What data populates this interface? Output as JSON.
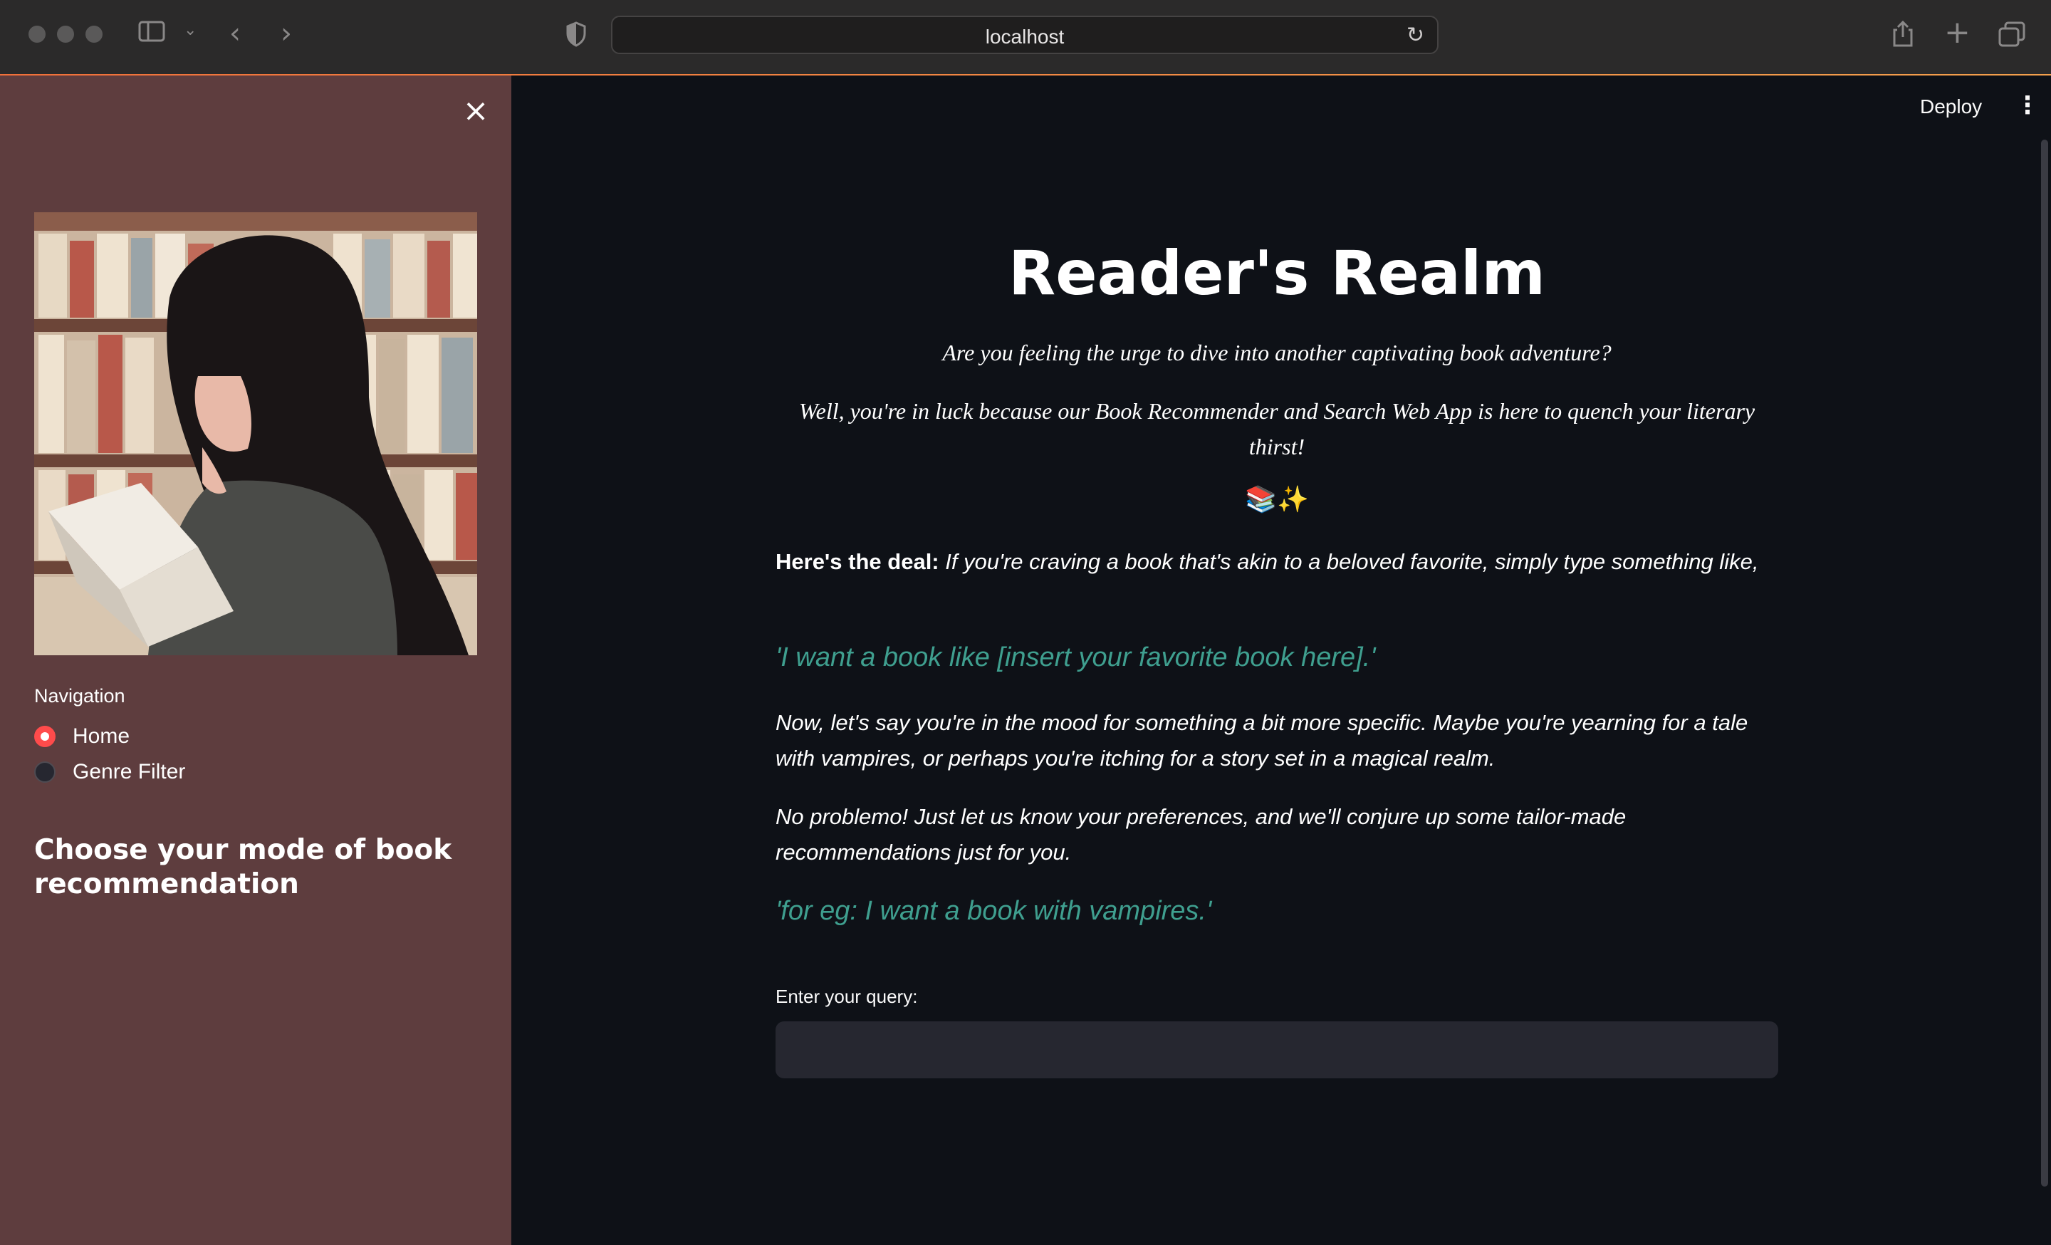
{
  "browser": {
    "url": "localhost"
  },
  "sidebar": {
    "close_label": "×",
    "image_desc": "anime-girl-reading-book-illustration",
    "navigation_label": "Navigation",
    "options": [
      {
        "label": "Home",
        "selected": true
      },
      {
        "label": "Genre Filter",
        "selected": false
      }
    ],
    "heading": "Choose your mode of book recommendation"
  },
  "header": {
    "deploy_label": "Deploy",
    "menu_icon": "⋮"
  },
  "main": {
    "title": "Reader's Realm",
    "intro_line1": "Are you feeling the urge to dive into another captivating book adventure?",
    "intro_line2": "Well, you're in luck because our Book Recommender and Search Web App is here to quench your literary thirst!",
    "emoji": "📚✨",
    "deal_bold": "Here's the deal:",
    "deal_text": " If you're craving a book that's akin to a beloved favorite, simply type something like,",
    "example1": "'I want a book like [insert your favorite book here].'",
    "para2": "Now, let's say you're in the mood for something a bit more specific. Maybe you're yearning for a tale with vampires, or perhaps you're itching for a story set in a magical realm.",
    "para3": "No problemo! Just let us know your preferences, and we'll conjure up some tailor-made recommendations just for you.",
    "example2": "'for eg: I want a book with vampires.'",
    "query_label": "Enter your query:",
    "query_value": ""
  },
  "colors": {
    "sidebar_bg": "#5e3d3e",
    "main_bg": "#0e1117",
    "accent": "#ff4b4b",
    "teal_text": "#3f9f8f"
  }
}
